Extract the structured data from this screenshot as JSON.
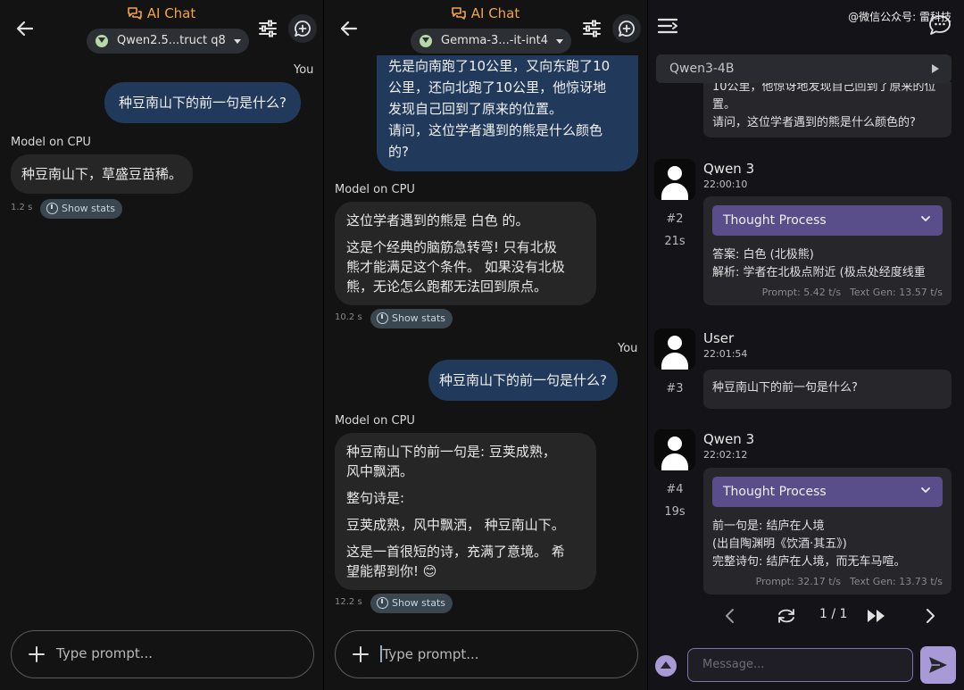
{
  "panel1": {
    "title": "AI Chat",
    "model_chip": "Qwen2.5...truct q8",
    "you_label": "You",
    "user_message": "种豆南山下的前一句是什么?",
    "model_label": "Model on CPU",
    "model_reply": "种豆南山下，草盛豆苗稀。",
    "duration": "1.2 s",
    "stats_label": "Show stats",
    "prompt_placeholder": "Type prompt..."
  },
  "panel2": {
    "title": "AI Chat",
    "model_chip": "Gemma-3...-it-int4",
    "user_message_1_lines": [
      "先是向南跑了10公里，又向东跑了10",
      "公里，还向北跑了10公里，他惊讶地",
      "发现自己回到了原来的位置。",
      "请问，这位学者遇到的熊是什么颜色",
      "的?"
    ],
    "model_label": "Model on CPU",
    "reply_1": {
      "p1": "这位学者遇到的熊是 白色 的。",
      "p2_lines": [
        "这是个经典的脑筋急转弯! 只有北极",
        "熊才能满足这个条件。 如果没有北极",
        "熊，无论怎么跑都无法回到原点。"
      ],
      "duration": "10.2 s"
    },
    "you_label": "You",
    "user_message_2": "种豆南山下的前一句是什么?",
    "reply_2": {
      "p1_lines": [
        "种豆南山下的前一句是: 豆荚成熟，",
        "风中飘洒。"
      ],
      "p2": "整句诗是:",
      "p3": "豆荚成熟，风中飘洒， 种豆南山下。",
      "p4_lines": [
        "这是一首很短的诗，充满了意境。 希",
        "望能帮到你! 😊"
      ],
      "duration": "12.2 s"
    },
    "stats_label": "Show stats",
    "prompt_placeholder": "Type prompt..."
  },
  "panel3": {
    "watermark": "@微信公众号: 雷科技",
    "model_selector": "Qwen3-4B",
    "top_card_lines": [
      "10公里，他惊讶地发现自己回到了原来的位",
      "置。",
      "请问，这位学者遇到的熊是什么颜色的?"
    ],
    "messages": [
      {
        "sender": "Qwen 3",
        "time": "22:00:10",
        "number": "#2",
        "duration": "21s",
        "thought_label": "Thought Process",
        "lines": [
          "答案: 白色 (北极熊)",
          "解析: 学者在北极点附近 (极点处经度线重"
        ],
        "prompt_speed": "Prompt: 5.42 t/s",
        "gen_speed": "Text Gen: 13.57 t/s"
      },
      {
        "sender": "User",
        "time": "22:01:54",
        "number": "#3",
        "text": "种豆南山下的前一句是什么?"
      },
      {
        "sender": "Qwen 3",
        "time": "22:02:12",
        "number": "#4",
        "duration": "19s",
        "thought_label": "Thought Process",
        "lines": [
          "前一句是: 结庐在人境",
          "(出自陶渊明《饮酒·其五》)",
          "完整诗句: 结庐在人境，而无车马喧。"
        ],
        "prompt_speed": "Prompt: 32.17 t/s",
        "gen_speed": "Text Gen: 13.73 t/s"
      }
    ],
    "pager": "1 / 1",
    "message_placeholder": "Message..."
  },
  "colors": {
    "accent_orange": "#f2a541",
    "user_bubble": "#213a5c",
    "model_bubble": "#262626",
    "thought_purple": "#5a4e8a",
    "send_purple": "#a79ad6"
  },
  "icons": [
    "back-arrow-icon",
    "chat-bubbles-icon",
    "download-icon",
    "chevron-down-icon",
    "tune-icon",
    "new-chat-icon",
    "timer-icon",
    "plus-icon",
    "menu-icon",
    "chat-icon",
    "play-icon",
    "avatar-icon",
    "chevron-left-icon",
    "regenerate-icon",
    "fast-forward-icon",
    "chevron-right-icon",
    "expand-icon",
    "send-icon"
  ]
}
